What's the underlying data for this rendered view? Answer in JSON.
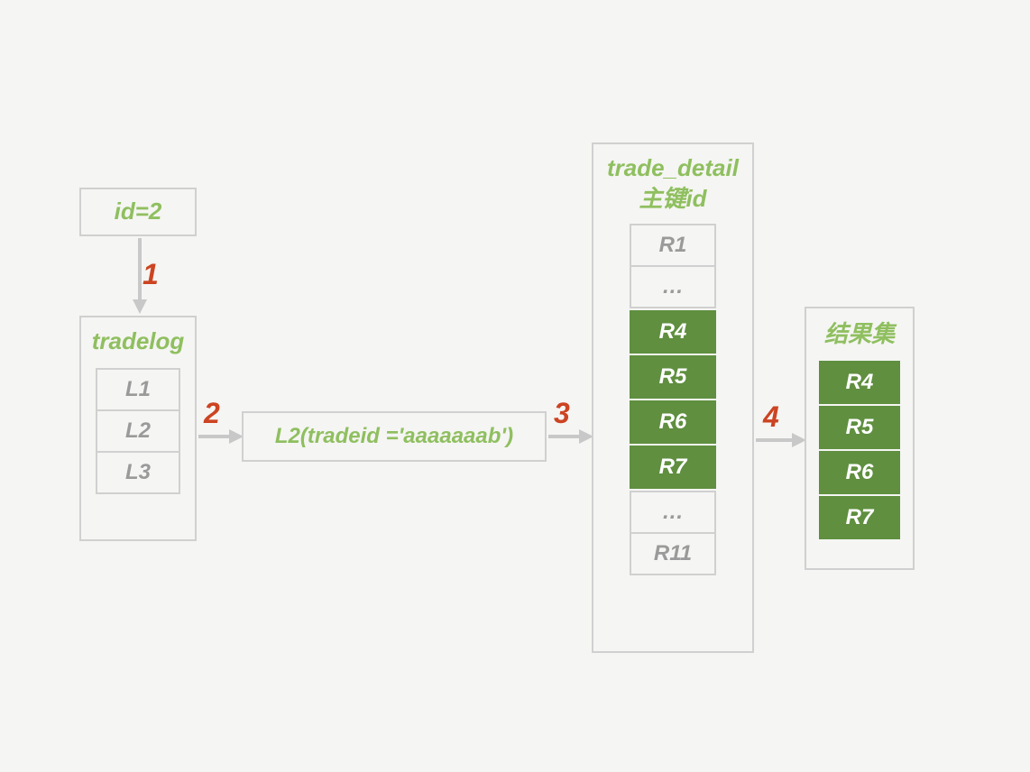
{
  "id_box": {
    "label": "id=2"
  },
  "tradelog": {
    "title": "tradelog",
    "rows": [
      "L1",
      "L2",
      "L3"
    ]
  },
  "middle": {
    "label": "L2(tradeid ='aaaaaaab')"
  },
  "trade_detail": {
    "title_line1": "trade_detail",
    "title_line2": "主键id",
    "rows": [
      {
        "v": "R1",
        "hl": false
      },
      {
        "v": "…",
        "hl": false
      },
      {
        "v": "R4",
        "hl": true
      },
      {
        "v": "R5",
        "hl": true
      },
      {
        "v": "R6",
        "hl": true
      },
      {
        "v": "R7",
        "hl": true
      },
      {
        "v": "…",
        "hl": false
      },
      {
        "v": "R11",
        "hl": false
      }
    ]
  },
  "result": {
    "title": "结果集",
    "rows": [
      "R4",
      "R5",
      "R6",
      "R7"
    ]
  },
  "steps": {
    "s1": "1",
    "s2": "2",
    "s3": "3",
    "s4": "4"
  }
}
